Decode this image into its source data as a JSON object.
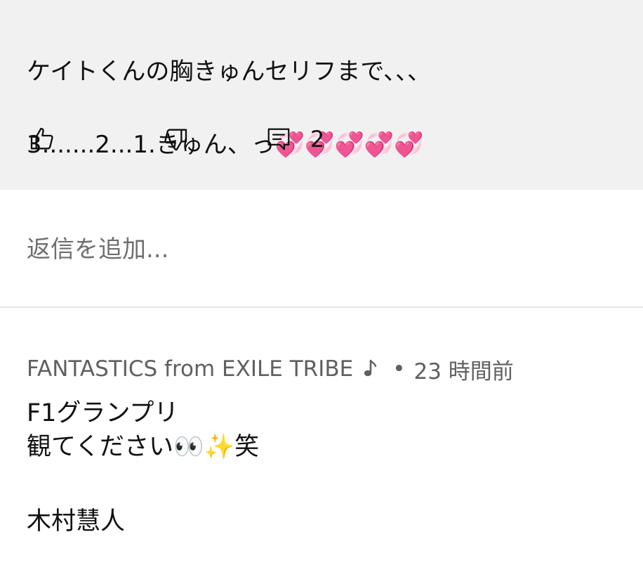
{
  "comment": {
    "text_line1": "ケイトくんの胸きゅんセリフまで、、、",
    "text_line2": "3.......2...1.きゅん、っ💞💞💞💞💞",
    "reply_count": "2",
    "icons": {
      "like": "thumbs-up-icon",
      "dislike": "thumbs-down-icon",
      "replies": "comment-icon"
    }
  },
  "reply_box": {
    "placeholder": "返信を追加..."
  },
  "reply": {
    "author": "FANTASTICS from EXILE TRIBE",
    "author_badge_icon": "music-note-icon",
    "separator": "•",
    "timestamp": "23 時間前",
    "body_lines": [
      "F1グランプリ",
      "観てください👀✨笑",
      "",
      "木村慧人"
    ]
  },
  "colors": {
    "panel_bg": "#f1f1f1",
    "meta_text": "#606060",
    "placeholder": "#6f6f6f",
    "divider": "#e5e5e5"
  }
}
